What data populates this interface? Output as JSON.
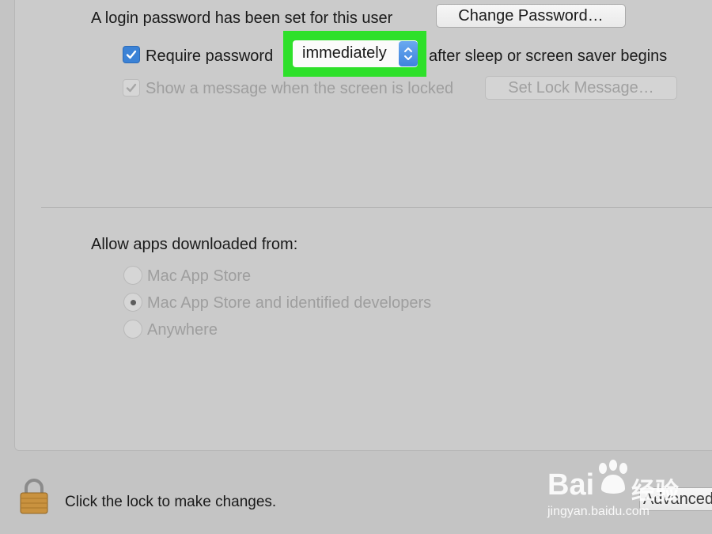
{
  "password": {
    "status_text": "A login password has been set for this user",
    "change_button": "Change Password…",
    "require_label": "Require password",
    "require_value": "immediately",
    "require_suffix": "after sleep or screen saver begins",
    "message_label": "Show a message when the screen is locked",
    "lock_message_button": "Set Lock Message…"
  },
  "apps": {
    "heading": "Allow apps downloaded from:",
    "options": [
      {
        "label": "Mac App Store",
        "selected": false
      },
      {
        "label": "Mac App Store and identified developers",
        "selected": true
      },
      {
        "label": "Anywhere",
        "selected": false
      }
    ]
  },
  "footer": {
    "lock_text": "Click the lock to make changes.",
    "advanced_button": "Advanced…"
  },
  "watermark": {
    "brand_latin": "Bai",
    "brand_cn": "经验",
    "url": "jingyan.baidu.com"
  },
  "colors": {
    "highlight": "#2ee02a",
    "accent": "#3b82d6"
  },
  "icons": [
    "checkmark-icon",
    "stepper-arrows-icon",
    "padlock-icon",
    "paw-icon"
  ]
}
